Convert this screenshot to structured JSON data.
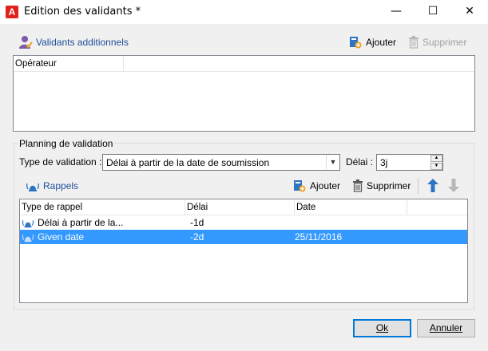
{
  "window": {
    "title": "Edition des validants *",
    "app_icon_letter": "A",
    "minimize_glyph": "—",
    "maximize_glyph": "☐",
    "close_glyph": "✕"
  },
  "validators": {
    "section_label": "Validants additionnels",
    "add_label": "Ajouter",
    "delete_label": "Supprimer",
    "columns": [
      "Opérateur"
    ]
  },
  "planning": {
    "group_title": "Planning de validation",
    "type_label": "Type de validation :",
    "type_value": "Délai à partir de la date de soumission",
    "delay_label": "Délai :",
    "delay_value": "3j"
  },
  "reminders": {
    "section_label": "Rappels",
    "add_label": "Ajouter",
    "delete_label": "Supprimer",
    "columns": [
      "Type de rappel",
      "Délai",
      "Date"
    ],
    "rows": [
      {
        "type": "Délai à partir de la...",
        "delay": "-1d",
        "date": "",
        "selected": false
      },
      {
        "type": "Given date",
        "delay": "-2d",
        "date": "25/11/2016",
        "selected": true
      }
    ]
  },
  "footer": {
    "ok_label": "Ok",
    "cancel_label": "Annuler"
  },
  "colors": {
    "selection": "#3399ff",
    "accent_blue": "#2d74c4",
    "app_red": "#e0211d"
  }
}
